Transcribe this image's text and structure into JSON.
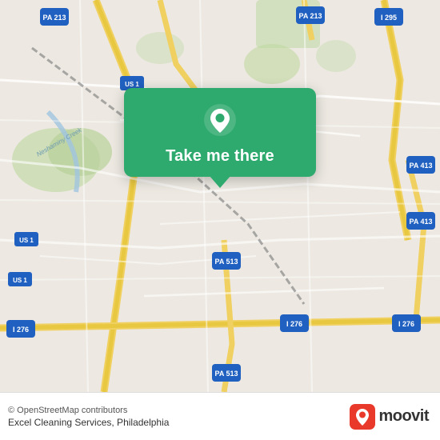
{
  "map": {
    "alt": "Street map of Philadelphia area"
  },
  "popup": {
    "label": "Take me there",
    "pin_icon": "location-pin"
  },
  "bottom_bar": {
    "attribution": "© OpenStreetMap contributors",
    "location_text": "Excel Cleaning Services, Philadelphia",
    "logo_text": "moovit"
  }
}
